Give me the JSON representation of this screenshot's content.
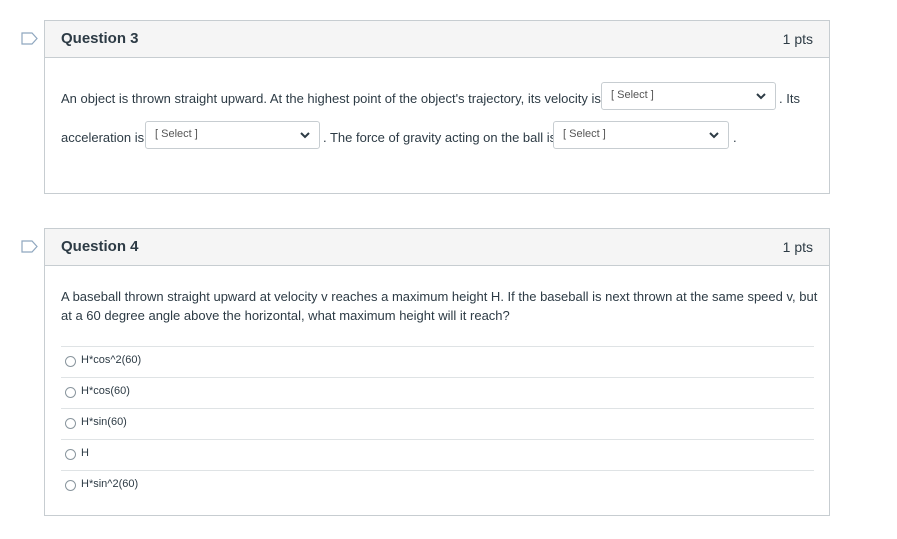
{
  "questions": [
    {
      "title": "Question 3",
      "points": "1 pts",
      "flag_icon": "bookmark-flag-icon",
      "text_parts": {
        "part1": "An object is thrown straight upward. At the highest point of the object's trajectory, its velocity is",
        "part2": ". Its",
        "part3": "acceleration is",
        "part4": ". The force of gravity acting on the ball is",
        "part5": "."
      },
      "selects": [
        {
          "value": "[ Select ]"
        },
        {
          "value": "[ Select ]"
        },
        {
          "value": "[ Select ]"
        }
      ]
    },
    {
      "title": "Question 4",
      "points": "1 pts",
      "flag_icon": "bookmark-flag-icon",
      "text": "A baseball thrown straight upward at velocity v reaches a maximum height H. If the baseball is next thrown at the same speed v, but at a 60 degree angle above the horizontal, what maximum height will it reach?",
      "answers": [
        {
          "label": "H*cos^2(60)",
          "selected": false
        },
        {
          "label": "H*cos(60)",
          "selected": false
        },
        {
          "label": "H*sin(60)",
          "selected": false
        },
        {
          "label": "H",
          "selected": false
        },
        {
          "label": "H*sin^2(60)",
          "selected": false
        }
      ]
    }
  ],
  "colors": {
    "border": "#c7cdd1",
    "header_bg": "#f5f5f5",
    "text": "#2d3b45",
    "flag": "#8fa7bf"
  }
}
